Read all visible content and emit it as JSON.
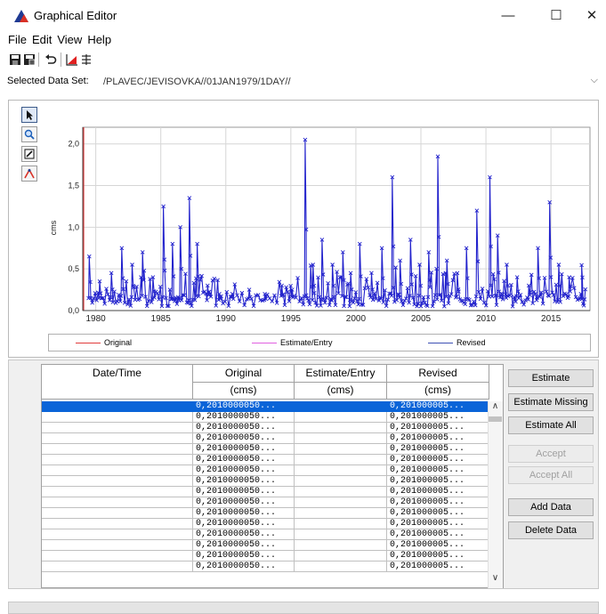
{
  "window": {
    "title": "Graphical Editor",
    "minimize": "—",
    "maximize": "☐",
    "close": "✕"
  },
  "menu": [
    "File",
    "Edit",
    "View",
    "Help"
  ],
  "toolbar": {
    "icons": [
      "save-icon",
      "save-as-icon",
      "undo-icon",
      "plot-icon",
      "table-icon"
    ]
  },
  "dataset": {
    "label": "Selected Data Set:",
    "value": "/PLAVEC/JEVISOVKA//01JAN1979/1DAY//"
  },
  "chart_tools": [
    "pointer-icon",
    "zoom-icon",
    "edit-icon",
    "draw-icon"
  ],
  "chart_data": {
    "type": "line",
    "ylabel": "cms",
    "xlim": [
      1979,
      2018
    ],
    "ylim": [
      0,
      2.2
    ],
    "x_ticks": [
      "1980",
      "1985",
      "1990",
      "1995",
      "2000",
      "2005",
      "2010",
      "2015"
    ],
    "y_ticks": [
      "0,0",
      "0,5",
      "1,0",
      "1,5",
      "2,0"
    ],
    "series": [
      {
        "name": "Revised",
        "color": "#2222cc",
        "peaks": [
          [
            1979.5,
            0.65
          ],
          [
            1980.3,
            0.35
          ],
          [
            1981.2,
            0.45
          ],
          [
            1982.0,
            0.75
          ],
          [
            1982.8,
            0.55
          ],
          [
            1983.6,
            0.7
          ],
          [
            1984.4,
            0.4
          ],
          [
            1985.2,
            1.25
          ],
          [
            1985.9,
            0.8
          ],
          [
            1986.5,
            1.0
          ],
          [
            1987.2,
            1.35
          ],
          [
            1987.8,
            0.8
          ],
          [
            1988.6,
            0.3
          ],
          [
            1989.5,
            0.2
          ],
          [
            1990.5,
            0.2
          ],
          [
            1991.8,
            0.25
          ],
          [
            1993.0,
            0.2
          ],
          [
            1994.3,
            0.3
          ],
          [
            1995.1,
            0.25
          ],
          [
            1996.1,
            2.05
          ],
          [
            1996.7,
            0.55
          ],
          [
            1997.4,
            0.85
          ],
          [
            1998.2,
            0.55
          ],
          [
            1999.0,
            0.7
          ],
          [
            1999.6,
            0.45
          ],
          [
            2000.3,
            0.8
          ],
          [
            2001.2,
            0.45
          ],
          [
            2002.0,
            0.75
          ],
          [
            2002.8,
            1.6
          ],
          [
            2003.4,
            0.6
          ],
          [
            2004.2,
            0.85
          ],
          [
            2004.9,
            0.55
          ],
          [
            2005.6,
            0.7
          ],
          [
            2006.3,
            1.85
          ],
          [
            2007.0,
            0.6
          ],
          [
            2007.8,
            0.45
          ],
          [
            2008.5,
            0.75
          ],
          [
            2009.3,
            1.2
          ],
          [
            2010.3,
            1.6
          ],
          [
            2010.9,
            0.9
          ],
          [
            2011.6,
            0.55
          ],
          [
            2012.4,
            0.4
          ],
          [
            2013.3,
            0.3
          ],
          [
            2014.0,
            0.75
          ],
          [
            2014.9,
            1.3
          ],
          [
            2015.6,
            0.55
          ],
          [
            2016.4,
            0.4
          ],
          [
            2017.3,
            0.2
          ]
        ]
      }
    ],
    "legend": [
      {
        "name": "Original",
        "color": "#e03a3a"
      },
      {
        "name": "Estimate/Entry",
        "color": "#e060e0"
      },
      {
        "name": "Revised",
        "color": "#3c50b4"
      }
    ]
  },
  "table": {
    "headers": [
      "Date/Time",
      "Original",
      "Estimate/Entry",
      "Revised"
    ],
    "units": [
      "",
      "(cms)",
      "(cms)",
      "(cms)"
    ],
    "rows": [
      {
        "date": "",
        "original": "0,2010000050...",
        "estimate": "",
        "revised": "0,201000005..."
      },
      {
        "date": "",
        "original": "0,2010000050...",
        "estimate": "",
        "revised": "0,201000005..."
      },
      {
        "date": "",
        "original": "0,2010000050...",
        "estimate": "",
        "revised": "0,201000005..."
      },
      {
        "date": "",
        "original": "0,2010000050...",
        "estimate": "",
        "revised": "0,201000005..."
      },
      {
        "date": "",
        "original": "0,2010000050...",
        "estimate": "",
        "revised": "0,201000005..."
      },
      {
        "date": "",
        "original": "0,2010000050...",
        "estimate": "",
        "revised": "0,201000005..."
      },
      {
        "date": "",
        "original": "0,2010000050...",
        "estimate": "",
        "revised": "0,201000005..."
      },
      {
        "date": "",
        "original": "0,2010000050...",
        "estimate": "",
        "revised": "0,201000005..."
      },
      {
        "date": "",
        "original": "0,2010000050...",
        "estimate": "",
        "revised": "0,201000005..."
      },
      {
        "date": "",
        "original": "0,2010000050...",
        "estimate": "",
        "revised": "0,201000005..."
      },
      {
        "date": "",
        "original": "0,2010000050...",
        "estimate": "",
        "revised": "0,201000005..."
      },
      {
        "date": "",
        "original": "0,2010000050...",
        "estimate": "",
        "revised": "0,201000005..."
      },
      {
        "date": "",
        "original": "0,2010000050...",
        "estimate": "",
        "revised": "0,201000005..."
      },
      {
        "date": "",
        "original": "0,2010000050...",
        "estimate": "",
        "revised": "0,201000005..."
      },
      {
        "date": "",
        "original": "0,2010000050...",
        "estimate": "",
        "revised": "0,201000005..."
      },
      {
        "date": "",
        "original": "0,2010000050...",
        "estimate": "",
        "revised": "0,201000005..."
      }
    ]
  },
  "buttons": [
    {
      "label": "Estimate",
      "enabled": true
    },
    {
      "label": "Estimate Missing",
      "enabled": true
    },
    {
      "label": "Estimate All",
      "enabled": true
    },
    {
      "label": "Accept",
      "enabled": false
    },
    {
      "label": "Accept All",
      "enabled": false
    },
    {
      "label": "Add Data",
      "enabled": true
    },
    {
      "label": "Delete Data",
      "enabled": true
    }
  ]
}
